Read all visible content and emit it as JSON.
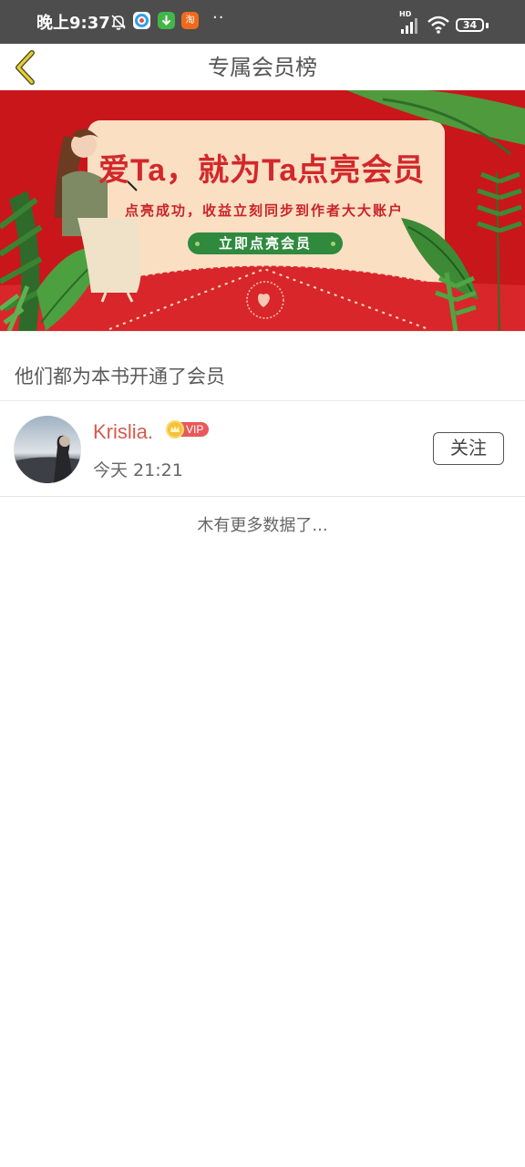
{
  "status_bar": {
    "time": "晚上9:37",
    "network": "HD",
    "battery": "34",
    "more": "··"
  },
  "header": {
    "title": "专属会员榜"
  },
  "banner": {
    "heading": "爱Ta，就为Ta点亮会员",
    "subtitle": "点亮成功，收益立刻同步到作者大大账户",
    "cta": "立即点亮会员"
  },
  "section": {
    "title": "他们都为本书开通了会员"
  },
  "members": [
    {
      "name": "Krislia.",
      "badge": "VIP",
      "time": "今天 21:21",
      "follow_label": "关注"
    }
  ],
  "footer": {
    "no_more": "木有更多数据了..."
  },
  "colors": {
    "banner_red": "#c9161b",
    "accent_yellow": "#e4cf3a",
    "name_red": "#d65a4e",
    "cta_green": "#2f8a3e"
  }
}
